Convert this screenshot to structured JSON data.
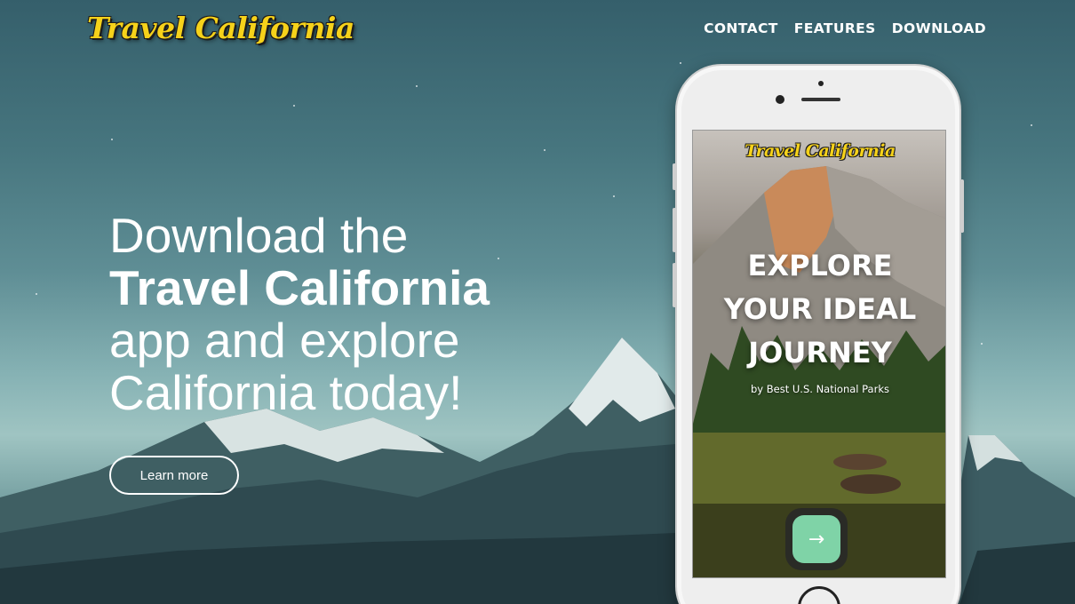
{
  "nav": {
    "logo": "Travel California",
    "links": [
      "CONTACT",
      "FEATURES",
      "DOWNLOAD"
    ]
  },
  "hero": {
    "headline_line1": "Download the",
    "headline_line2": "Travel California",
    "headline_line3": "app and explore",
    "headline_line4": "California today!",
    "cta_label": "Learn more"
  },
  "phone_screen": {
    "logo": "Travel California",
    "title_lines": [
      "EXPLORE",
      "YOUR IDEAL",
      "JOURNEY"
    ],
    "subtitle": "by Best U.S. National Parks",
    "next_icon": "arrow-right-icon"
  },
  "colors": {
    "logo_yellow": "#f6d21a",
    "button_green": "#7fd3a7",
    "text_white": "#ffffff"
  }
}
